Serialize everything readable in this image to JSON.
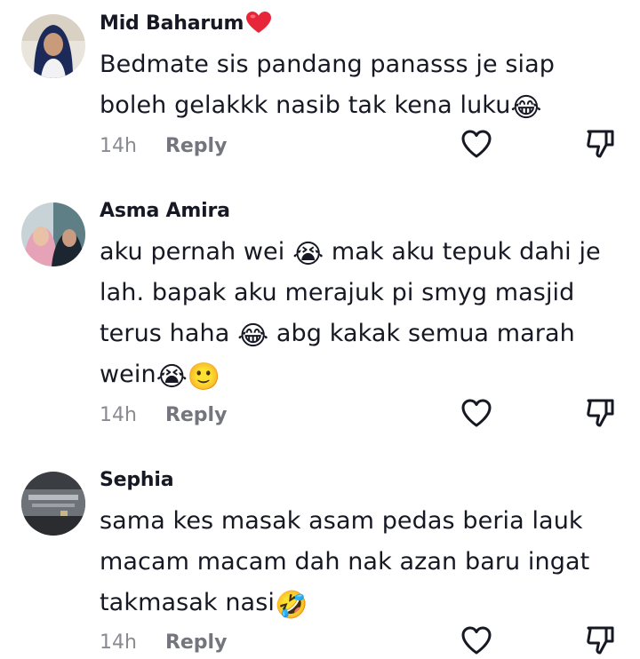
{
  "comments": [
    {
      "username": "Mid Baharum",
      "username_emoji": "heart-emoji",
      "text": "Bedmate sis pandang panasss je siap boleh gelakkk nasib tak kena luku",
      "trailing_emoji": "😂",
      "time": "14h",
      "reply_label": "Reply"
    },
    {
      "username": "Asma Amira",
      "text_parts": [
        "aku pernah wei ",
        "😭",
        " mak aku tepuk dahi je lah. bapak aku merajuk pi smyg masjid terus haha ",
        "😂",
        " abg kakak semua marah wein",
        "😭",
        "🙂"
      ],
      "time": "14h",
      "reply_label": "Reply"
    },
    {
      "username": "Sephia",
      "text": "sama kes masak asam pedas beria lauk macam macam dah nak azan baru ingat takmasak nasi",
      "trailing_emoji": "🤣",
      "time": "14h",
      "reply_label": "Reply"
    }
  ],
  "icons": {
    "like": "heart-outline-icon",
    "dislike": "thumbs-down-outline-icon"
  },
  "colors": {
    "text": "#161823",
    "meta": "#8a8b91",
    "reply": "#75767d",
    "heart": "#fe2c55"
  }
}
